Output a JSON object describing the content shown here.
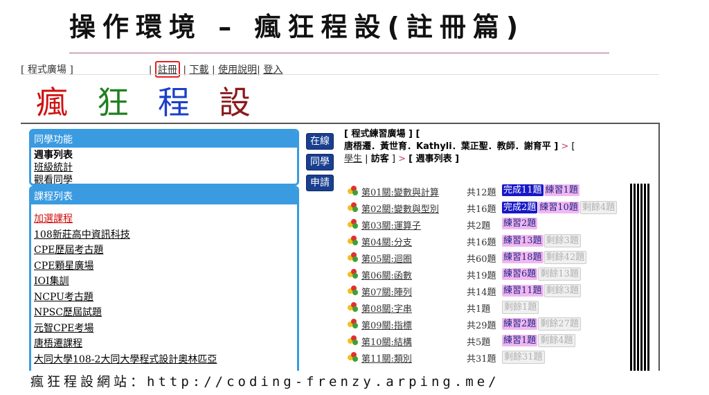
{
  "slide_title": "操作環境 – 瘋狂程設(註冊篇)",
  "topnav": {
    "plaza": "[ 程式廣場 ]",
    "bar1": "|",
    "register": "註冊",
    "bar2": "|",
    "download": "下載",
    "bar3": "|",
    "manual": "使用說明",
    "bar4": "|",
    "login": "登入"
  },
  "logo": {
    "chars": [
      "瘋",
      "狂",
      "程",
      "設"
    ],
    "colors": [
      "#d01010",
      "#208020",
      "#1a3fc8",
      "#8a1a1a"
    ]
  },
  "classmate_panel": {
    "title": "同學功能",
    "items": [
      "週事列表",
      "班級統計",
      "觀看同學"
    ]
  },
  "course_panel": {
    "title": "課程列表",
    "items": [
      "加選課程",
      "108新莊高中資訊科技",
      "CPE歷屆考古題",
      "CPE顆星廣場",
      "IOI集訓",
      "NCPU考古題",
      "NPSC歷屆試題",
      "元智CPE考場",
      "唐梧遷課程",
      "大同大學108-2大同大學程式設計奧林匹亞"
    ]
  },
  "side_buttons": [
    "在線",
    "同學",
    "申請"
  ],
  "breadcrumb": {
    "line1": "[ 程式練習廣場 ] [",
    "teachers": "唐梧遷．黃世育．Kathyli．葉正聖．教師．謝育平 ]",
    "arrow1": ">",
    "bracket": "[",
    "student": "學生",
    "bar": "|",
    "guest": "訪客",
    "close": "]",
    "arrow2": ">",
    "current": "[ 週事列表 ]"
  },
  "levels": [
    {
      "name": "第01關:變數與計算",
      "total": "共12題",
      "done": "完成11題",
      "practice": "練習1題",
      "left": ""
    },
    {
      "name": "第02關:變數與型別",
      "total": "共16題",
      "done": "完成2題",
      "practice": "練習10題",
      "left": "剩餘4題"
    },
    {
      "name": "第03關:運算子",
      "total": "共2題",
      "done": "",
      "practice": "練習2題",
      "left": ""
    },
    {
      "name": "第04關:分支",
      "total": "共16題",
      "done": "",
      "practice": "練習13題",
      "left": "剩餘3題"
    },
    {
      "name": "第05關:迴圈",
      "total": "共60題",
      "done": "",
      "practice": "練習18題",
      "left": "剩餘42題"
    },
    {
      "name": "第06關:函數",
      "total": "共19題",
      "done": "",
      "practice": "練習6題",
      "left": "剩餘13題"
    },
    {
      "name": "第07關:陣列",
      "total": "共14題",
      "done": "",
      "practice": "練習11題",
      "left": "剩餘3題"
    },
    {
      "name": "第08關:字串",
      "total": "共1題",
      "done": "",
      "practice": "",
      "left": "剩餘1題"
    },
    {
      "name": "第09關:指標",
      "total": "共29題",
      "done": "",
      "practice": "練習2題",
      "left": "剩餘27題"
    },
    {
      "name": "第10關:結構",
      "total": "共5題",
      "done": "",
      "practice": "練習1題",
      "left": "剩餘4題"
    },
    {
      "name": "第11關:類別",
      "total": "共31題",
      "done": "",
      "practice": "",
      "left": "剩餘31題"
    }
  ],
  "footer": "瘋狂程設網站：http://coding-frenzy.arping.me/"
}
